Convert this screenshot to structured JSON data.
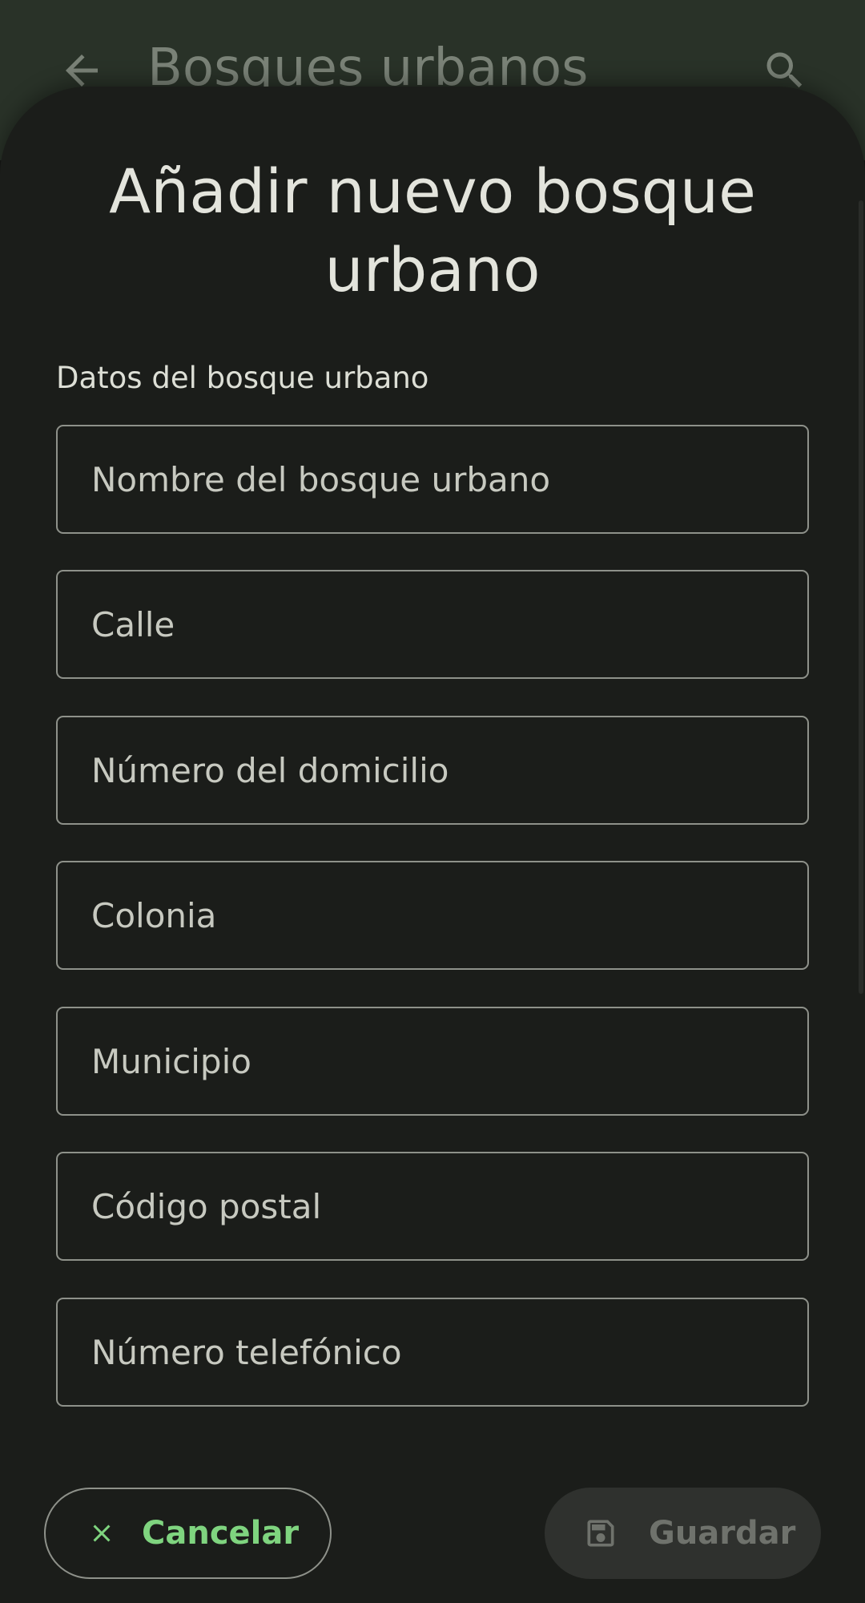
{
  "appbar": {
    "title": "Bosques urbanos",
    "back_icon": "arrow-back-icon",
    "search_icon": "search-icon"
  },
  "sheet": {
    "title": "Añadir nuevo bosque urbano",
    "section_label": "Datos del bosque urbano",
    "fields": [
      {
        "placeholder": "Nombre del bosque urbano",
        "value": ""
      },
      {
        "placeholder": "Calle",
        "value": ""
      },
      {
        "placeholder": "Número del domicilio",
        "value": ""
      },
      {
        "placeholder": "Colonia",
        "value": ""
      },
      {
        "placeholder": "Municipio",
        "value": ""
      },
      {
        "placeholder": "Código postal",
        "value": ""
      },
      {
        "placeholder": "Número telefónico",
        "value": ""
      }
    ],
    "cancel_label": "Cancelar",
    "cancel_icon": "close-icon",
    "save_label": "Guardar",
    "save_icon": "save-icon"
  },
  "colors": {
    "accent": "#7fd47f",
    "appbar_bg": "#2f3a2e",
    "sheet_bg": "#1b1d1a",
    "disabled_button_bg": "#2f312e"
  }
}
